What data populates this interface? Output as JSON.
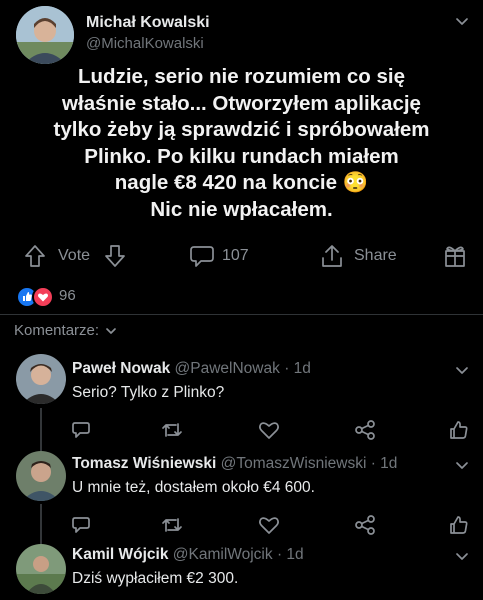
{
  "post": {
    "author_name": "Michał Kowalski",
    "author_handle": "@MichalKowalski",
    "text_lines": [
      "Ludzie, serio nie rozumiem co się",
      "właśnie stało... Otworzyłem aplikację",
      "tylko żeby ją sprawdzić i spróbowałem",
      "Plinko. Po kilku rundach miałem",
      "nagle €8 420 na koncie 😳",
      "Nic nie wpłacałem."
    ],
    "actions": {
      "vote_label": "Vote",
      "comment_count": "107",
      "share_label": "Share"
    },
    "reactions_count": "96"
  },
  "comments_header": {
    "label": "Komentarze:"
  },
  "comments": [
    {
      "name": "Paweł Nowak",
      "handle": "@PawelNowak",
      "time": "· 1d",
      "text": "Serio? Tylko z Plinko?"
    },
    {
      "name": "Tomasz Wiśniewski",
      "handle": "@TomaszWisniewski",
      "time": "· 1d",
      "text": "U mnie też, dostałem około €4 600."
    },
    {
      "name": "Kamil Wójcik",
      "handle": "@KamilWojcik",
      "time": "· 1d",
      "text": "Dziś wypłaciłem €2 300."
    }
  ],
  "colors": {
    "background": "#000000",
    "text": "#e7e9ea",
    "muted": "#71767b",
    "like_blue": "#1877f2",
    "love_red": "#f33e58"
  }
}
